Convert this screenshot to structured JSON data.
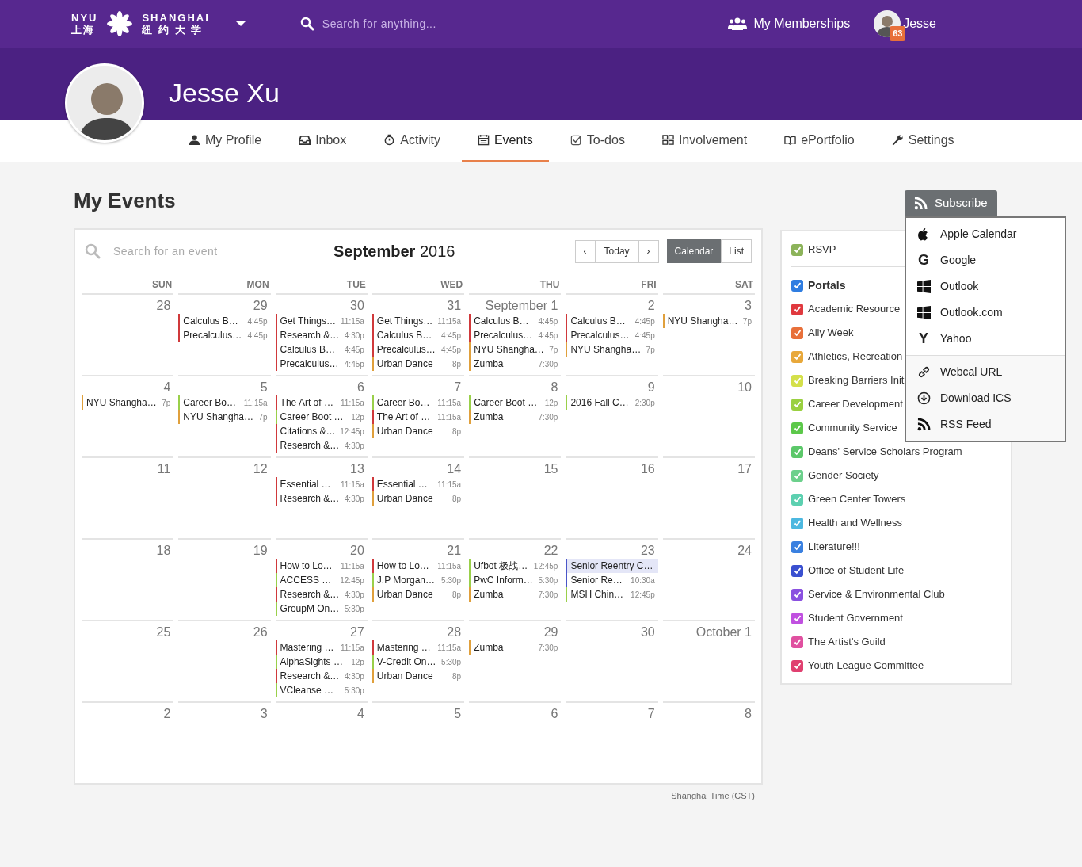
{
  "topbar": {
    "logo": {
      "left_top": "NYU",
      "left_bottom": "上海",
      "right_top": "SHANGHAI",
      "right_bottom": "纽 约 大 学"
    },
    "search": {
      "placeholder": "Search for anything..."
    },
    "memberships": "My Memberships",
    "user": {
      "name": "Jesse",
      "badge": "63"
    }
  },
  "profile": {
    "name": "Jesse Xu"
  },
  "tabs": [
    {
      "label": "My Profile",
      "selected": false
    },
    {
      "label": "Inbox",
      "selected": false
    },
    {
      "label": "Activity",
      "selected": false
    },
    {
      "label": "Events",
      "selected": true
    },
    {
      "label": "To-dos",
      "selected": false
    },
    {
      "label": "Involvement",
      "selected": false
    },
    {
      "label": "ePortfolio",
      "selected": false
    },
    {
      "label": "Settings",
      "selected": false
    }
  ],
  "page_title": "My Events",
  "calendar": {
    "search": {
      "placeholder": "Search for an event"
    },
    "title": "**September** 2016",
    "prev": "‹",
    "today": "Today",
    "next": "›",
    "views": [
      {
        "label": "Calendar",
        "selected": true
      },
      {
        "label": "List",
        "selected": false
      }
    ],
    "weekdays": [
      "SUN",
      "MON",
      "TUE",
      "WED",
      "THU",
      "FRI",
      "SAT"
    ],
    "weeks": [
      [
        {
          "day": "28"
        },
        {
          "day": "29",
          "events": [
            {
              "kind": "timed",
              "title": "Calculus B…",
              "time": "4:45p",
              "color": "#d0393b"
            },
            {
              "kind": "timed",
              "title": "Precalculus…",
              "time": "4:45p",
              "color": "#d0393b"
            }
          ]
        },
        {
          "day": "30",
          "events": [
            {
              "kind": "timed",
              "title": "Get Things…",
              "time": "11:15a",
              "color": "#d0393b"
            },
            {
              "kind": "timed",
              "title": "Research &…",
              "time": "4:30p",
              "color": "#d0393b"
            },
            {
              "kind": "timed",
              "title": "Calculus B…",
              "time": "4:45p",
              "color": "#d0393b"
            },
            {
              "kind": "timed",
              "title": "Precalculus…",
              "time": "4:45p",
              "color": "#d0393b"
            }
          ]
        },
        {
          "day": "31",
          "events": [
            {
              "kind": "timed",
              "title": "Get Things…",
              "time": "11:15a",
              "color": "#d0393b"
            },
            {
              "kind": "timed",
              "title": "Calculus B…",
              "time": "4:45p",
              "color": "#d0393b"
            },
            {
              "kind": "timed",
              "title": "Precalculus…",
              "time": "4:45p",
              "color": "#d0393b"
            },
            {
              "kind": "timed",
              "title": "Urban Dance",
              "time": "8p",
              "color": "#e0a03c"
            }
          ]
        },
        {
          "day": "September 1",
          "events": [
            {
              "kind": "timed",
              "title": "Calculus B…",
              "time": "4:45p",
              "color": "#d0393b"
            },
            {
              "kind": "timed",
              "title": "Precalculus…",
              "time": "4:45p",
              "color": "#d0393b"
            },
            {
              "kind": "timed",
              "title": "NYU Shangha…",
              "time": "7p",
              "color": "#e0a03c"
            },
            {
              "kind": "timed",
              "title": "Zumba",
              "time": "7:30p",
              "color": "#e0a03c"
            }
          ]
        },
        {
          "day": "2",
          "events": [
            {
              "kind": "timed",
              "title": "Calculus B…",
              "time": "4:45p",
              "color": "#d0393b"
            },
            {
              "kind": "timed",
              "title": "Precalculus…",
              "time": "4:45p",
              "color": "#d0393b"
            },
            {
              "kind": "timed",
              "title": "NYU Shangha…",
              "time": "7p",
              "color": "#e0a03c"
            }
          ]
        },
        {
          "day": "3",
          "events": [
            {
              "kind": "timed",
              "title": "NYU Shangha…",
              "time": "7p",
              "color": "#e0a03c"
            }
          ]
        }
      ],
      [
        {
          "day": "4",
          "events": [
            {
              "kind": "timed",
              "title": "NYU Shangha…",
              "time": "7p",
              "color": "#e0a03c"
            }
          ]
        },
        {
          "day": "5",
          "events": [
            {
              "kind": "timed",
              "title": "Career Bo…",
              "time": "11:15a",
              "color": "#9ad04a"
            },
            {
              "kind": "timed",
              "title": "NYU Shangha…",
              "time": "7p",
              "color": "#e0a03c"
            }
          ]
        },
        {
          "day": "6",
          "events": [
            {
              "kind": "timed",
              "title": "The Art of …",
              "time": "11:15a",
              "color": "#d0393b"
            },
            {
              "kind": "timed",
              "title": "Career Boot …",
              "time": "12p",
              "color": "#9ad04a"
            },
            {
              "kind": "timed",
              "title": "Citations &…",
              "time": "12:45p",
              "color": "#d0393b"
            },
            {
              "kind": "timed",
              "title": "Research &…",
              "time": "4:30p",
              "color": "#d0393b"
            }
          ]
        },
        {
          "day": "7",
          "events": [
            {
              "kind": "timed",
              "title": "Career Bo…",
              "time": "11:15a",
              "color": "#9ad04a"
            },
            {
              "kind": "timed",
              "title": "The Art of …",
              "time": "11:15a",
              "color": "#d0393b"
            },
            {
              "kind": "timed",
              "title": "Urban Dance",
              "time": "8p",
              "color": "#e0a03c"
            }
          ]
        },
        {
          "day": "8",
          "events": [
            {
              "kind": "timed",
              "title": "Career Boot …",
              "time": "12p",
              "color": "#9ad04a"
            },
            {
              "kind": "timed",
              "title": "Zumba",
              "time": "7:30p",
              "color": "#e0a03c"
            }
          ]
        },
        {
          "day": "9",
          "events": [
            {
              "kind": "timed",
              "title": "2016 Fall C…",
              "time": "2:30p",
              "color": "#9ad04a"
            }
          ]
        },
        {
          "day": "10"
        }
      ],
      [
        {
          "day": "11"
        },
        {
          "day": "12"
        },
        {
          "day": "13",
          "events": [
            {
              "kind": "timed",
              "title": "Essential …",
              "time": "11:15a",
              "color": "#d0393b"
            },
            {
              "kind": "timed",
              "title": "Research &…",
              "time": "4:30p",
              "color": "#d0393b"
            }
          ]
        },
        {
          "day": "14",
          "events": [
            {
              "kind": "timed",
              "title": "Essential …",
              "time": "11:15a",
              "color": "#d0393b"
            },
            {
              "kind": "timed",
              "title": "Urban Dance",
              "time": "8p",
              "color": "#e0a03c"
            }
          ]
        },
        {
          "day": "15"
        },
        {
          "day": "16"
        },
        {
          "day": "17"
        }
      ],
      [
        {
          "day": "18"
        },
        {
          "day": "19"
        },
        {
          "day": "20",
          "events": [
            {
              "kind": "timed",
              "title": "How to Lo…",
              "time": "11:15a",
              "color": "#d0393b"
            },
            {
              "kind": "timed",
              "title": "ACCESS …",
              "time": "12:45p",
              "color": "#9ad04a"
            },
            {
              "kind": "timed",
              "title": "Research &…",
              "time": "4:30p",
              "color": "#d0393b"
            },
            {
              "kind": "timed",
              "title": "GroupM On…",
              "time": "5:30p",
              "color": "#9ad04a"
            }
          ]
        },
        {
          "day": "21",
          "events": [
            {
              "kind": "timed",
              "title": "How to Lo…",
              "time": "11:15a",
              "color": "#d0393b"
            },
            {
              "kind": "timed",
              "title": "J.P Morgan…",
              "time": "5:30p",
              "color": "#9ad04a"
            },
            {
              "kind": "timed",
              "title": "Urban Dance",
              "time": "8p",
              "color": "#e0a03c"
            }
          ]
        },
        {
          "day": "22",
          "events": [
            {
              "kind": "timed",
              "title": "Ufbot 极战…",
              "time": "12:45p",
              "color": "#9ad04a"
            },
            {
              "kind": "timed",
              "title": "PwC Inform…",
              "time": "5:30p",
              "color": "#9ad04a"
            },
            {
              "kind": "timed",
              "title": "Zumba",
              "time": "7:30p",
              "color": "#e0a03c"
            }
          ]
        },
        {
          "day": "23",
          "events": [
            {
              "kind": "allday",
              "title": "Senior Reentry C…",
              "color": "#4a56c8"
            },
            {
              "kind": "timed",
              "title": "Senior Re…",
              "time": "10:30a",
              "color": "#4a56c8"
            },
            {
              "kind": "timed",
              "title": "MSH Chin…",
              "time": "12:45p",
              "color": "#9ad04a"
            }
          ]
        },
        {
          "day": "24"
        }
      ],
      [
        {
          "day": "25"
        },
        {
          "day": "26"
        },
        {
          "day": "27",
          "events": [
            {
              "kind": "timed",
              "title": "Mastering …",
              "time": "11:15a",
              "color": "#d0393b"
            },
            {
              "kind": "timed",
              "title": "AlphaSights …",
              "time": "12p",
              "color": "#9ad04a"
            },
            {
              "kind": "timed",
              "title": "Research &…",
              "time": "4:30p",
              "color": "#d0393b"
            },
            {
              "kind": "timed",
              "title": "VCleanse …",
              "time": "5:30p",
              "color": "#9ad04a"
            }
          ]
        },
        {
          "day": "28",
          "events": [
            {
              "kind": "timed",
              "title": "Mastering …",
              "time": "11:15a",
              "color": "#d0393b"
            },
            {
              "kind": "timed",
              "title": "V-Credit On…",
              "time": "5:30p",
              "color": "#9ad04a"
            },
            {
              "kind": "timed",
              "title": "Urban Dance",
              "time": "8p",
              "color": "#e0a03c"
            }
          ]
        },
        {
          "day": "29",
          "events": [
            {
              "kind": "timed",
              "title": "Zumba",
              "time": "7:30p",
              "color": "#e0a03c"
            }
          ]
        },
        {
          "day": "30"
        },
        {
          "day": "October 1"
        }
      ],
      [
        {
          "day": "2"
        },
        {
          "day": "3"
        },
        {
          "day": "4"
        },
        {
          "day": "5"
        },
        {
          "day": "6"
        },
        {
          "day": "7"
        },
        {
          "day": "8"
        }
      ]
    ],
    "timezone": "Shanghai Time (CST)"
  },
  "filters": {
    "rsvp": {
      "label": "RSVP",
      "checked": true,
      "color": "#8cb35a"
    },
    "portals": {
      "label": "Portals",
      "checked": true,
      "color": "#2f7de1",
      "items": [
        {
          "label": "Academic Resource",
          "checked": true,
          "color": "#e0393e"
        },
        {
          "label": "Ally Week",
          "checked": true,
          "color": "#e8703a"
        },
        {
          "label": "Athletics, Recreation",
          "checked": true,
          "color": "#e8a83a"
        },
        {
          "label": "Breaking Barriers Init",
          "checked": true,
          "color": "#d4e04a"
        },
        {
          "label": "Career Development",
          "checked": true,
          "color": "#9ad040"
        },
        {
          "label": "Community Service",
          "checked": true,
          "color": "#5cc84a"
        },
        {
          "label": "Deans' Service Scholars Program",
          "checked": true,
          "color": "#5cc86a"
        },
        {
          "label": "Gender Society",
          "checked": true,
          "color": "#6cd08c"
        },
        {
          "label": "Green Center Towers",
          "checked": true,
          "color": "#5cd0b0"
        },
        {
          "label": "Health and Wellness",
          "checked": true,
          "color": "#4cb8e0"
        },
        {
          "label": "Literature!!!",
          "checked": true,
          "color": "#3a80e0"
        },
        {
          "label": "Office of Student Life",
          "checked": true,
          "color": "#3a50d0"
        },
        {
          "label": "Service & Environmental Club",
          "checked": true,
          "color": "#8a50e0"
        },
        {
          "label": "Student Government",
          "checked": true,
          "color": "#c050e0"
        },
        {
          "label": "The Artist's Guild",
          "checked": true,
          "color": "#e050a0"
        },
        {
          "label": "Youth League Committee",
          "checked": true,
          "color": "#e04070"
        }
      ]
    }
  },
  "subscribe": {
    "label": "Subscribe",
    "expanded": true,
    "sections": [
      [
        {
          "label": "Apple Calendar"
        },
        {
          "label": "Google",
          "glyph": "G"
        },
        {
          "label": "Outlook"
        },
        {
          "label": "Outlook.com"
        },
        {
          "label": "Yahoo",
          "glyph": "Y"
        }
      ],
      [
        {
          "label": "Webcal URL"
        },
        {
          "label": "Download ICS"
        },
        {
          "label": "RSS Feed"
        }
      ]
    ]
  }
}
